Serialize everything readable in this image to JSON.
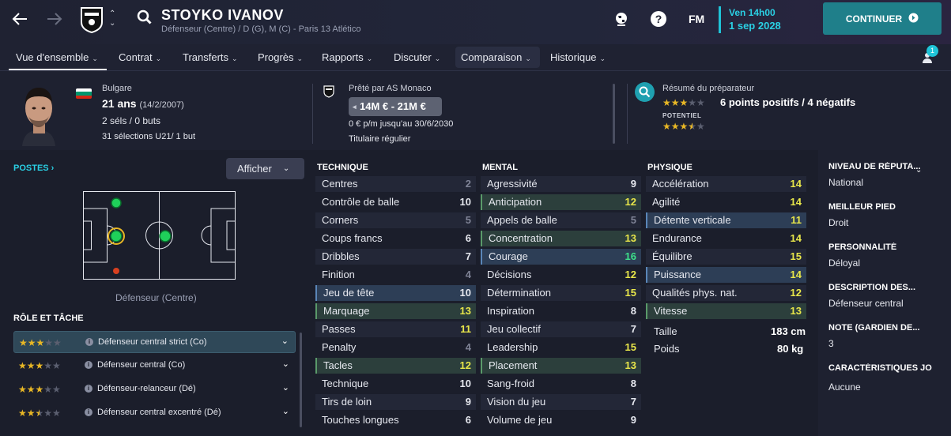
{
  "header": {
    "name": "STOYKO IVANOV",
    "subtitle": "Défenseur (Centre) / D (G), M (C) - Paris 13 Atlético",
    "time": "Ven 14h00",
    "date": "1 sep 2028",
    "continue": "CONTINUER",
    "fm": "FM",
    "notif_count": "1"
  },
  "tabs": [
    "Vue d'ensemble",
    "Contrat",
    "Transferts",
    "Progrès",
    "Rapports",
    "Discuter",
    "Comparaison",
    "Historique"
  ],
  "info": {
    "nationality": "Bulgare",
    "age": "21 ans",
    "dob": "(14/2/2007)",
    "caps": "2 séls / 0 buts",
    "u21": "31 sélections U21/ 1 but",
    "loan": "Prêté par AS Monaco",
    "value": "14M € - 21M €",
    "wage": "0 € p/m jusqu'au 30/6/2030",
    "status": "Titulaire régulier",
    "scout_title": "Résumé du préparateur",
    "scout_summary": "6 points positifs / 4 négatifs",
    "potential_label": "POTENTIEL",
    "current_stars": 3,
    "potential_stars": 3.5
  },
  "left": {
    "postes": "POSTES",
    "afficher": "Afficher",
    "position_label": "Défenseur (Centre)",
    "role_header": "RÔLE ET TÂCHE",
    "roles": [
      {
        "name": "Défenseur central strict (Co)",
        "stars": 3
      },
      {
        "name": "Défenseur central (Co)",
        "stars": 3
      },
      {
        "name": "Défenseur-relanceur (Dé)",
        "stars": 3
      },
      {
        "name": "Défenseur central excentré (Dé)",
        "stars": 2.5
      }
    ]
  },
  "technique": {
    "title": "TECHNIQUE",
    "attrs": [
      [
        "Centres",
        "2"
      ],
      [
        "Contrôle de balle",
        "10"
      ],
      [
        "Corners",
        "5"
      ],
      [
        "Coups francs",
        "6"
      ],
      [
        "Dribbles",
        "7"
      ],
      [
        "Finition",
        "4"
      ],
      [
        "Jeu de tête",
        "10"
      ],
      [
        "Marquage",
        "13"
      ],
      [
        "Passes",
        "11"
      ],
      [
        "Penalty",
        "4"
      ],
      [
        "Tacles",
        "12"
      ],
      [
        "Technique",
        "10"
      ],
      [
        "Tirs de loin",
        "9"
      ],
      [
        "Touches longues",
        "6"
      ]
    ]
  },
  "mental": {
    "title": "MENTAL",
    "attrs": [
      [
        "Agressivité",
        "9"
      ],
      [
        "Anticipation",
        "12"
      ],
      [
        "Appels de balle",
        "5"
      ],
      [
        "Concentration",
        "13"
      ],
      [
        "Courage",
        "16"
      ],
      [
        "Décisions",
        "12"
      ],
      [
        "Détermination",
        "15"
      ],
      [
        "Inspiration",
        "8"
      ],
      [
        "Jeu collectif",
        "7"
      ],
      [
        "Leadership",
        "15"
      ],
      [
        "Placement",
        "13"
      ],
      [
        "Sang-froid",
        "8"
      ],
      [
        "Vision du jeu",
        "7"
      ],
      [
        "Volume de jeu",
        "9"
      ]
    ]
  },
  "physique": {
    "title": "PHYSIQUE",
    "attrs": [
      [
        "Accélération",
        "14"
      ],
      [
        "Agilité",
        "14"
      ],
      [
        "Détente verticale",
        "11"
      ],
      [
        "Endurance",
        "14"
      ],
      [
        "Équilibre",
        "15"
      ],
      [
        "Puissance",
        "14"
      ],
      [
        "Qualités phys. nat.",
        "12"
      ],
      [
        "Vitesse",
        "13"
      ]
    ],
    "height_label": "Taille",
    "height": "183 cm",
    "weight_label": "Poids",
    "weight": "80 kg"
  },
  "right": [
    {
      "h": "NIVEAU DE RÉPUTA...",
      "v": "National"
    },
    {
      "h": "MEILLEUR PIED",
      "v": "Droit"
    },
    {
      "h": "PERSONNALITÉ",
      "v": "Déloyal"
    },
    {
      "h": "DESCRIPTION DES...",
      "v": "Défenseur central"
    },
    {
      "h": "NOTE (GARDIEN DE...",
      "v": "3"
    },
    {
      "h": "CARACTÉRISTIQUES JO",
      "v": "Aucune"
    }
  ]
}
